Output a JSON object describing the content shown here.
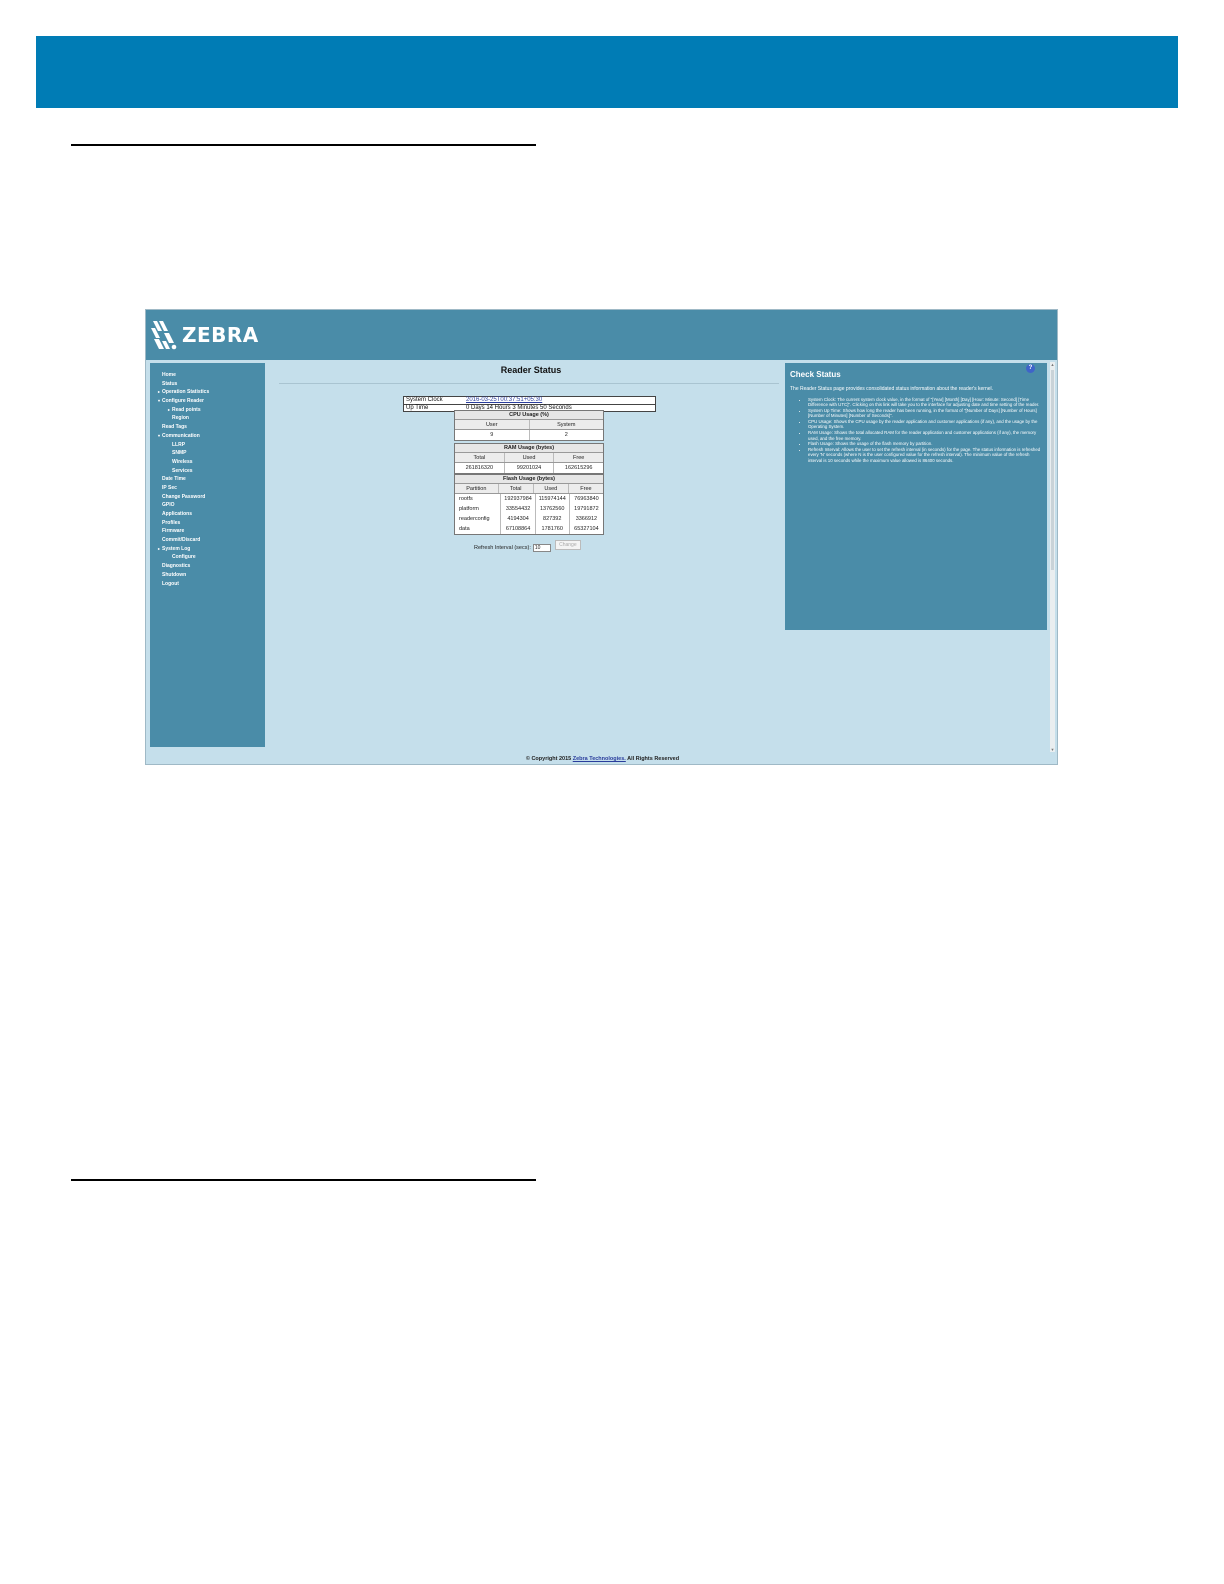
{
  "zebra": {
    "logo_text": "ZEBRA"
  },
  "nav": {
    "items": [
      {
        "label": "Home",
        "level": 0,
        "arrow": ""
      },
      {
        "label": "Status",
        "level": 0,
        "arrow": ""
      },
      {
        "label": "Operation Statistics",
        "level": 0,
        "arrow": "▸"
      },
      {
        "label": "Configure Reader",
        "level": 0,
        "arrow": "▾"
      },
      {
        "label": "Read points",
        "level": 1,
        "arrow": "▸"
      },
      {
        "label": "Region",
        "level": 1,
        "arrow": ""
      },
      {
        "label": "Read Tags",
        "level": 0,
        "arrow": ""
      },
      {
        "label": "Communication",
        "level": 0,
        "arrow": "▾"
      },
      {
        "label": "LLRP",
        "level": 1,
        "arrow": ""
      },
      {
        "label": "SNMP",
        "level": 1,
        "arrow": ""
      },
      {
        "label": "Wireless",
        "level": 1,
        "arrow": ""
      },
      {
        "label": "Services",
        "level": 1,
        "arrow": ""
      },
      {
        "label": "Date Time",
        "level": 0,
        "arrow": ""
      },
      {
        "label": "IP Sec",
        "level": 0,
        "arrow": ""
      },
      {
        "label": "Change Password",
        "level": 0,
        "arrow": ""
      },
      {
        "label": "GPIO",
        "level": 0,
        "arrow": ""
      },
      {
        "label": "Applications",
        "level": 0,
        "arrow": ""
      },
      {
        "label": "Profiles",
        "level": 0,
        "arrow": ""
      },
      {
        "label": "Firmware",
        "level": 0,
        "arrow": ""
      },
      {
        "label": "Commit/Discard",
        "level": 0,
        "arrow": ""
      },
      {
        "label": "System Log",
        "level": 0,
        "arrow": "▸"
      },
      {
        "label": "Configure",
        "level": 2,
        "arrow": ""
      },
      {
        "label": "Diagnostics",
        "level": 0,
        "arrow": ""
      },
      {
        "label": "Shutdown",
        "level": 0,
        "arrow": ""
      },
      {
        "label": "Logout",
        "level": 0,
        "arrow": ""
      }
    ]
  },
  "main": {
    "title": "Reader Status",
    "system_clock_label": "System Clock",
    "system_clock_value": "2016-03-25T00:37:51+05:30",
    "uptime_label": "Up Time",
    "uptime_value": "0 Days 14 Hours 3 Minutes 50 Seconds",
    "cpu": {
      "heading": "CPU Usage (%)",
      "columns": [
        "User",
        "System"
      ],
      "values": [
        "9",
        "2"
      ]
    },
    "ram": {
      "heading": "RAM Usage (bytes)",
      "columns": [
        "Total",
        "Used",
        "Free"
      ],
      "values": [
        "261816320",
        "99201024",
        "162615296"
      ]
    },
    "flash": {
      "heading": "Flash Usage (bytes)",
      "columns": [
        "Partition",
        "Total",
        "Used",
        "Free"
      ],
      "rows": [
        [
          "rootfs",
          "192937984",
          "115974144",
          "76963840"
        ],
        [
          "platform",
          "33554432",
          "13762560",
          "19791872"
        ],
        [
          "readerconfig",
          "4194304",
          "827392",
          "3366912"
        ],
        [
          "data",
          "67108864",
          "1781760",
          "65327104"
        ]
      ]
    },
    "refresh_label": "Refresh Interval (secs):",
    "refresh_value": "10",
    "change_button": "Change"
  },
  "help": {
    "title": "Check Status",
    "question": "?",
    "intro": "The Reader Status page provides consolidated status information about the reader's kernel.",
    "items": [
      "System Clock: The current system clock value, in the format of \"[Year] [Month] [Day] [Hour: Minute: Second] [Time Difference with UTC]\". Clicking on this link will take you to the interface for adjusting date and time setting of the reader.",
      "System Up Time: Shows how long the reader has been running, in the format of \"[Number of Days] [Number of Hours] [Number of Minutes] [Number of Seconds]\".",
      "CPU Usage: Shows the CPU usage by the reader application and customer applications (if any), and the usage by the Operating System.",
      "RAM Usage: Shows the total allocated RAM for the reader application and customer applications (if any), the memory used, and the free memory.",
      "Flash Usage: Shows the usage of the flash memory by partition.",
      "Refresh Interval: Allows the user to set the refresh interval (in seconds) for the page. The status information is refreshed every 'N' seconds (where N is the user configured value for the refresh interval). The minimum value of the refresh interval is 10 seconds while the maximum value allowed is 86400 seconds."
    ]
  },
  "footer": {
    "prefix": "© Copyright 2015",
    "link": "Zebra Technologies.",
    "suffix": "All Rights Reserved"
  },
  "colors": {
    "banner": "#007cb5",
    "zebra_header": "#4a8ca8",
    "page_background": "#c5dfeb"
  }
}
